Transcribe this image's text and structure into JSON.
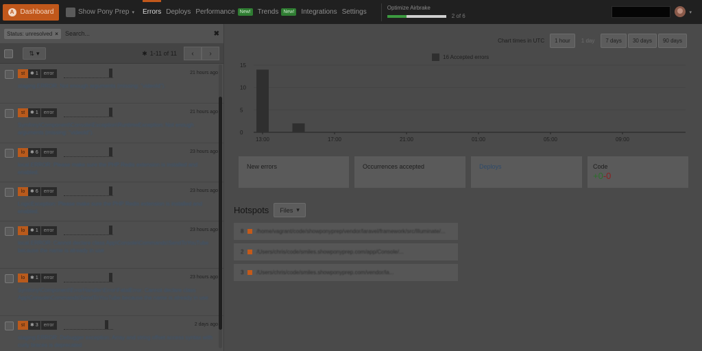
{
  "topbar": {
    "dashboard_label": "Dashboard",
    "dashboard_logo": "A",
    "project_name": "Show Pony Prep",
    "nav": [
      {
        "label": "Errors",
        "active": true,
        "badge": ""
      },
      {
        "label": "Deploys",
        "active": false,
        "badge": ""
      },
      {
        "label": "Performance",
        "active": false,
        "badge": "New!"
      },
      {
        "label": "Trends",
        "active": false,
        "badge": "New!"
      },
      {
        "label": "Integrations",
        "active": false,
        "badge": ""
      },
      {
        "label": "Settings",
        "active": false,
        "badge": ""
      }
    ],
    "optimize": {
      "label": "Optimize Airbrake",
      "progress_fraction": 0.33,
      "count": "2 of 6"
    },
    "colors": {
      "brand": "#c1581b",
      "new_badge": "#2f7d32",
      "progress": "#3c9a40"
    }
  },
  "filters": {
    "status_chip": "Status: unresolved",
    "search_placeholder": "Search...",
    "pagination": "1-11 of 11"
  },
  "errors": [
    {
      "env": "st",
      "count": "1",
      "type": "error",
      "time": "21 hours ago",
      "message": "staging.ERROR: Not enough arguments (missing: \"videoId\").",
      "spark": [
        0,
        0,
        0,
        0,
        0,
        0,
        0,
        0,
        0,
        0,
        0,
        1
      ]
    },
    {
      "env": "st",
      "count": "1",
      "type": "error",
      "time": "21 hours ago",
      "message": "Symfony\\Component\\Console\\Exception\\RuntimeException: Not enough arguments (missing: \"videoId\").",
      "spark": [
        0,
        0,
        0,
        0,
        0,
        0,
        0,
        0,
        0,
        0,
        0,
        1
      ]
    },
    {
      "env": "lo",
      "count": "6",
      "type": "error",
      "time": "23 hours ago",
      "message": "local.ERROR: Please make sure the PHP Redis extension is installed and enabled.",
      "spark": [
        0,
        0,
        0,
        0,
        0,
        0,
        0,
        0,
        0,
        0,
        0,
        1
      ]
    },
    {
      "env": "lo",
      "count": "6",
      "type": "error",
      "time": "23 hours ago",
      "message": "LogicException: Please make sure the PHP Redis extension is installed and enabled.",
      "spark": [
        0,
        0,
        0,
        0,
        0,
        0,
        0,
        0,
        0,
        0,
        0,
        1
      ]
    },
    {
      "env": "lo",
      "count": "1",
      "type": "error",
      "time": "23 hours ago",
      "message": "local.ERROR: Cannot declare class App\\Console\\Commands\\SendToYouTube because the name is already in use",
      "spark": [
        0,
        0,
        0,
        0,
        0,
        0,
        0,
        0,
        0,
        0,
        0,
        1
      ]
    },
    {
      "env": "lo",
      "count": "1",
      "type": "error",
      "time": "23 hours ago",
      "message": "Symfony\\Component\\ErrorHandler\\Error\\FatalError: Cannot declare class App\\Console\\Commands\\SendToYouTube because the name is already in use",
      "spark": [
        0,
        0,
        0,
        0,
        0,
        0,
        0,
        0,
        0,
        0,
        0,
        1
      ]
    },
    {
      "env": "st",
      "count": "3",
      "type": "error",
      "time": "2 days ago",
      "message": "staging.ERROR: Debugger exception: Array and string offset access syntax with curly braces is deprecated",
      "spark": [
        0,
        0,
        0,
        0,
        0,
        0,
        0,
        0,
        0,
        0,
        1,
        0
      ]
    }
  ],
  "chart": {
    "times_label": "Chart times in UTC",
    "ranges": [
      {
        "label": "1 hour",
        "active": false
      },
      {
        "label": "1 day",
        "active": true
      },
      {
        "label": "7 days",
        "active": false
      },
      {
        "label": "30 days",
        "active": false
      },
      {
        "label": "90 days",
        "active": false
      }
    ]
  },
  "chart_data": {
    "type": "bar",
    "title": "",
    "series": [
      {
        "name": "16 Accepted errors",
        "values": [
          14,
          2
        ]
      }
    ],
    "x": [
      "13:00",
      "14:00"
    ],
    "x_ticks": [
      "13:00",
      "17:00",
      "21:00",
      "01:00",
      "05:00",
      "09:00"
    ],
    "y_ticks": [
      0,
      5,
      10,
      15
    ],
    "ylim": [
      0,
      15
    ],
    "xlim_hours_span": 24,
    "grid": true,
    "legend": "top",
    "bar_color": "#2f2f2f"
  },
  "stats": {
    "new_errors": "New errors",
    "occurrences": "Occurrences accepted",
    "deploys": "Deploys",
    "code": "Code",
    "code_plus": "+0",
    "code_minus": "-0"
  },
  "hotspots": {
    "title": "Hotspots",
    "files_label": "Files",
    "items": [
      {
        "num": "8",
        "path": "/home/vagrant/code/showponyprep/vendor/laravel/framework/src/Illuminate/..."
      },
      {
        "num": "2",
        "path": "/Users/chris/code/smiles.showponyprep.com/app/Console/..."
      },
      {
        "num": "3",
        "path": "/Users/chris/code/smiles.showponyprep.com/vendor/la..."
      }
    ]
  }
}
